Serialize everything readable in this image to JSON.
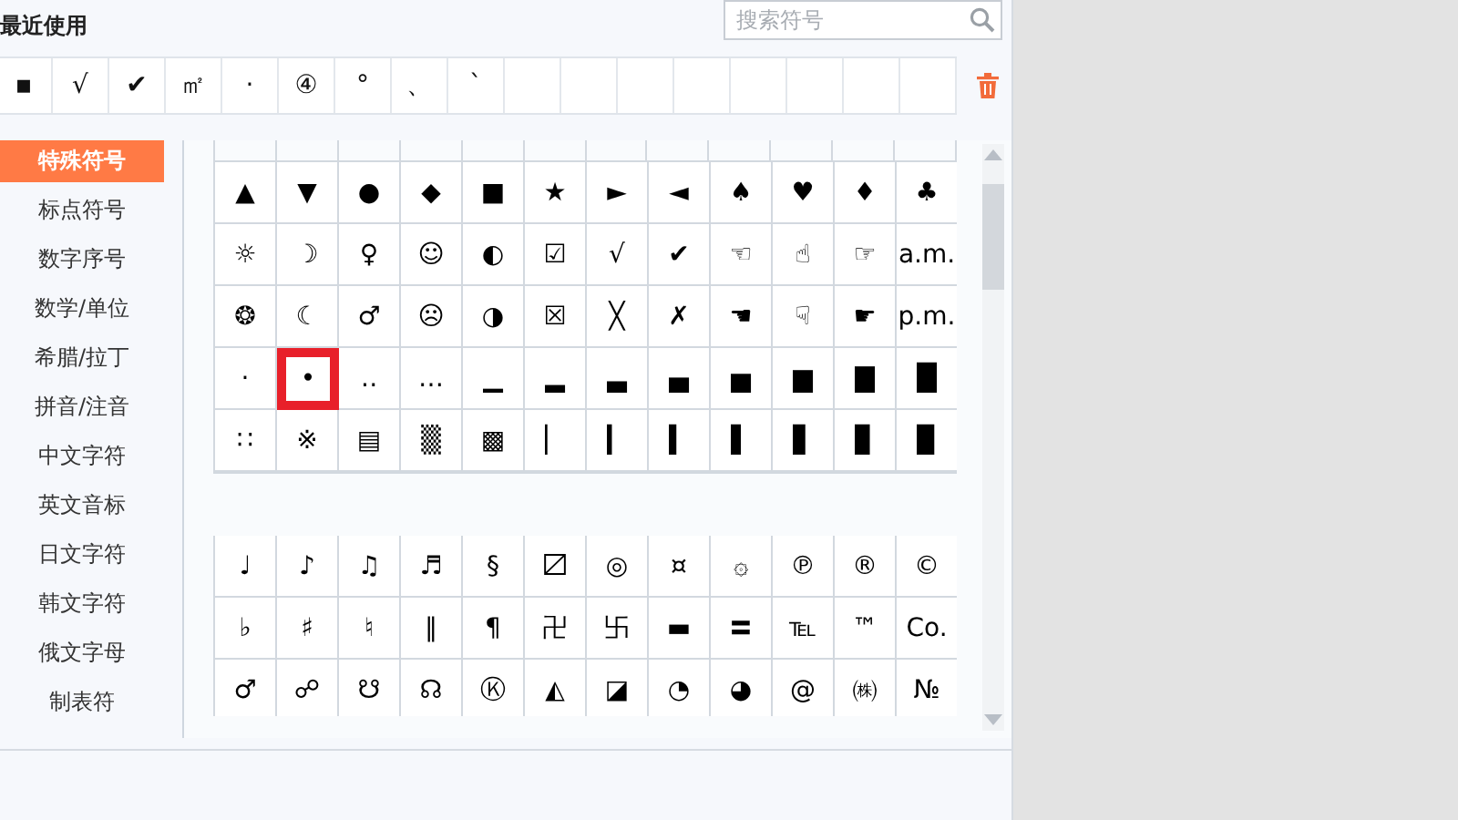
{
  "recent": {
    "title": "最近使用",
    "symbols": [
      "▪",
      "√",
      "✔",
      "㎡",
      "·",
      "④",
      "°",
      "、",
      "`"
    ]
  },
  "search": {
    "placeholder": "搜索符号"
  },
  "categories": [
    {
      "label": "特殊符号",
      "selected": true
    },
    {
      "label": "标点符号",
      "selected": false
    },
    {
      "label": "数字序号",
      "selected": false
    },
    {
      "label": "数学/单位",
      "selected": false
    },
    {
      "label": "希腊/拉丁",
      "selected": false
    },
    {
      "label": "拼音/注音",
      "selected": false
    },
    {
      "label": "中文字符",
      "selected": false
    },
    {
      "label": "英文音标",
      "selected": false
    },
    {
      "label": "日文字符",
      "selected": false
    },
    {
      "label": "韩文字符",
      "selected": false
    },
    {
      "label": "俄文字母",
      "selected": false
    },
    {
      "label": "制表符",
      "selected": false
    }
  ],
  "grids": [
    {
      "rows": [
        [
          {
            "symbol": "▲",
            "selected": false
          },
          {
            "symbol": "▼",
            "selected": false
          },
          {
            "symbol": "●",
            "selected": false
          },
          {
            "symbol": "◆",
            "selected": false
          },
          {
            "symbol": "■",
            "selected": false
          },
          {
            "symbol": "★",
            "selected": false
          },
          {
            "symbol": "►",
            "selected": false
          },
          {
            "symbol": "◄",
            "selected": false
          },
          {
            "symbol": "♠",
            "selected": false
          },
          {
            "symbol": "♥",
            "selected": false
          },
          {
            "symbol": "♦",
            "selected": false
          },
          {
            "symbol": "♣",
            "selected": false
          }
        ],
        [
          {
            "symbol": "☼",
            "selected": false
          },
          {
            "symbol": "☽",
            "selected": false
          },
          {
            "symbol": "♀",
            "selected": false
          },
          {
            "symbol": "☺",
            "selected": false
          },
          {
            "symbol": "◐",
            "selected": false
          },
          {
            "symbol": "☑",
            "selected": false
          },
          {
            "symbol": "√",
            "selected": false
          },
          {
            "symbol": "✔",
            "selected": false
          },
          {
            "symbol": "☜",
            "selected": false
          },
          {
            "symbol": "☝",
            "selected": false
          },
          {
            "symbol": "☞",
            "selected": false
          },
          {
            "symbol": "a.m.",
            "selected": false
          }
        ],
        [
          {
            "symbol": "❂",
            "selected": false
          },
          {
            "symbol": "☾",
            "selected": false
          },
          {
            "symbol": "♂",
            "selected": false
          },
          {
            "symbol": "☹",
            "selected": false
          },
          {
            "symbol": "◑",
            "selected": false
          },
          {
            "symbol": "☒",
            "selected": false
          },
          {
            "symbol": "╳",
            "selected": false
          },
          {
            "symbol": "✗",
            "selected": false
          },
          {
            "symbol": "☚",
            "selected": false
          },
          {
            "symbol": "☟",
            "selected": false
          },
          {
            "symbol": "☛",
            "selected": false
          },
          {
            "symbol": "p.m.",
            "selected": false
          }
        ],
        [
          {
            "symbol": "·",
            "selected": false
          },
          {
            "symbol": "•",
            "selected": true
          },
          {
            "symbol": "‥",
            "selected": false
          },
          {
            "symbol": "…",
            "selected": false
          },
          {
            "symbol": "▁",
            "selected": false
          },
          {
            "symbol": "▂",
            "selected": false
          },
          {
            "symbol": "▃",
            "selected": false
          },
          {
            "symbol": "▄",
            "selected": false
          },
          {
            "symbol": "▅",
            "selected": false
          },
          {
            "symbol": "▆",
            "selected": false
          },
          {
            "symbol": "▇",
            "selected": false
          },
          {
            "symbol": "█",
            "selected": false
          }
        ],
        [
          {
            "symbol": "∷",
            "selected": false
          },
          {
            "symbol": "※",
            "selected": false
          },
          {
            "symbol": "▤",
            "selected": false
          },
          {
            "symbol": "▒",
            "selected": false
          },
          {
            "symbol": "▩",
            "selected": false
          },
          {
            "symbol": "▏",
            "selected": false
          },
          {
            "symbol": "▎",
            "selected": false
          },
          {
            "symbol": "▍",
            "selected": false
          },
          {
            "symbol": "▌",
            "selected": false
          },
          {
            "symbol": "▋",
            "selected": false
          },
          {
            "symbol": "▊",
            "selected": false
          },
          {
            "symbol": "▉",
            "selected": false
          }
        ]
      ]
    },
    {
      "rows": [
        [
          {
            "symbol": "♩",
            "selected": false
          },
          {
            "symbol": "♪",
            "selected": false
          },
          {
            "symbol": "♫",
            "selected": false
          },
          {
            "symbol": "♬",
            "selected": false
          },
          {
            "symbol": "§",
            "selected": false
          },
          {
            "symbol": "〼",
            "selected": false
          },
          {
            "symbol": "◎",
            "selected": false
          },
          {
            "symbol": "¤",
            "selected": false
          },
          {
            "symbol": "۞",
            "selected": false
          },
          {
            "symbol": "℗",
            "selected": false
          },
          {
            "symbol": "®",
            "selected": false
          },
          {
            "symbol": "©",
            "selected": false
          }
        ],
        [
          {
            "symbol": "♭",
            "selected": false
          },
          {
            "symbol": "♯",
            "selected": false
          },
          {
            "symbol": "♮",
            "selected": false
          },
          {
            "symbol": "‖",
            "selected": false
          },
          {
            "symbol": "¶",
            "selected": false
          },
          {
            "symbol": "卍",
            "selected": false
          },
          {
            "symbol": "卐",
            "selected": false
          },
          {
            "symbol": "▬",
            "selected": false
          },
          {
            "symbol": "〓",
            "selected": false
          },
          {
            "symbol": "℡",
            "selected": false
          },
          {
            "symbol": "™",
            "selected": false
          },
          {
            "symbol": "Co.",
            "selected": false
          }
        ],
        [
          {
            "symbol": "♂",
            "selected": false
          },
          {
            "symbol": "☍",
            "selected": false
          },
          {
            "symbol": "☋",
            "selected": false
          },
          {
            "symbol": "☊",
            "selected": false
          },
          {
            "symbol": "Ⓚ",
            "selected": false
          },
          {
            "symbol": "◭",
            "selected": false
          },
          {
            "symbol": "◪",
            "selected": false
          },
          {
            "symbol": "◔",
            "selected": false
          },
          {
            "symbol": "◕",
            "selected": false
          },
          {
            "symbol": "@",
            "selected": false
          },
          {
            "symbol": "㈱",
            "selected": false
          },
          {
            "symbol": "№",
            "selected": false
          }
        ]
      ]
    }
  ]
}
